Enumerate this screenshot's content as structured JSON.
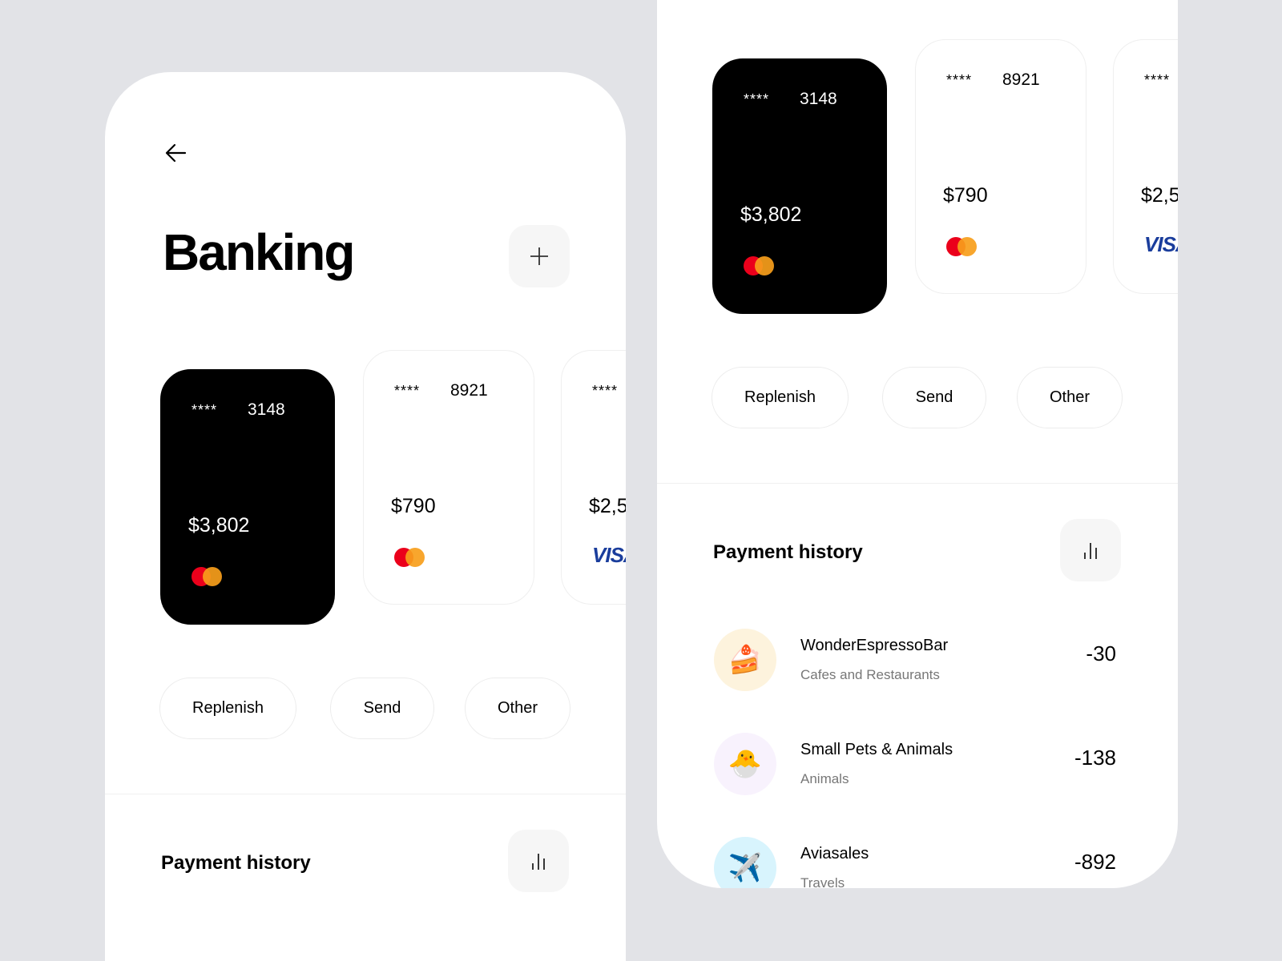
{
  "header": {
    "title": "Banking",
    "back_icon": "arrow-left-icon",
    "add_icon": "plus-icon"
  },
  "cards": [
    {
      "masked": "****",
      "last4": "3148",
      "balance": "$3,802",
      "network": "mastercard",
      "theme": "dark"
    },
    {
      "masked": "****",
      "last4": "8921",
      "balance": "$790",
      "network": "mastercard",
      "theme": "light"
    },
    {
      "masked": "****",
      "last4": "",
      "balance": "$2,5",
      "network": "VISA",
      "theme": "light"
    }
  ],
  "actions": {
    "replenish": "Replenish",
    "send": "Send",
    "other": "Other"
  },
  "payment_history": {
    "title": "Payment history",
    "chart_icon": "bar-chart-icon",
    "items": [
      {
        "name": "WonderEspressoBar",
        "category": "Cafes and Restaurants",
        "amount": "-30",
        "emoji": "🍰",
        "bg": "#fdf3dd"
      },
      {
        "name": "Small Pets & Animals",
        "category": "Animals",
        "amount": "-138",
        "emoji": "🐣",
        "bg": "#f8f2fd"
      },
      {
        "name": "Aviasales",
        "category": "Travels",
        "amount": "-892",
        "emoji": "✈️",
        "bg": "#d8f4fd"
      }
    ]
  },
  "colors": {
    "mastercard_red": "#eb001b",
    "mastercard_orange": "#f79e1b",
    "visa_blue": "#1a3d9c"
  }
}
